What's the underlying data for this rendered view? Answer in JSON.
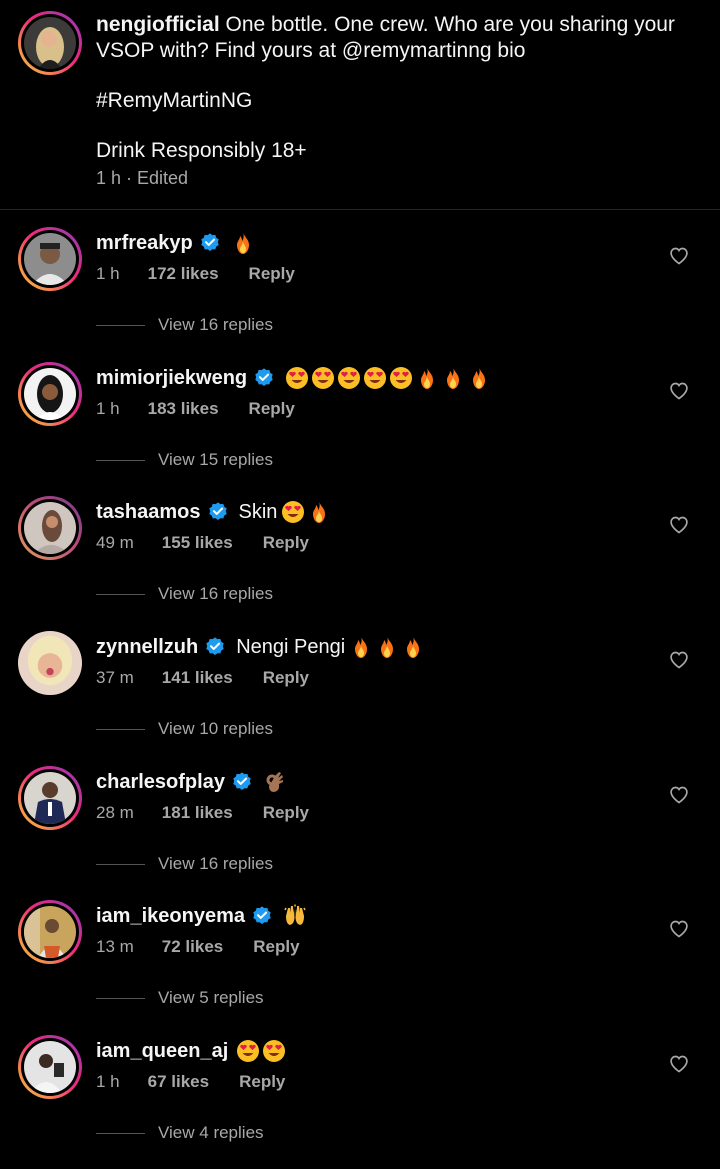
{
  "caption": {
    "username": "nengiofficial",
    "text": "One bottle. One crew. Who are you sharing your VSOP with? Find yours at @remymartinng bio",
    "hashtag": "#RemyMartinNG",
    "note": "Drink Responsibly 18+",
    "meta": "1 h · Edited"
  },
  "comments": [
    {
      "username": "mrfreakyp",
      "verified": true,
      "text": "",
      "emojis": [
        "fire"
      ],
      "time": "1 h",
      "likes": "172 likes",
      "reply": "Reply",
      "view_replies": "View 16 replies",
      "avatar": "ring"
    },
    {
      "username": "mimiorjiekweng",
      "verified": true,
      "text": "",
      "emojis": [
        "heart-eyes",
        "heart-eyes",
        "heart-eyes",
        "heart-eyes",
        "heart-eyes",
        "fire",
        "fire",
        "fire"
      ],
      "time": "1 h",
      "likes": "183 likes",
      "reply": "Reply",
      "view_replies": "View 15 replies",
      "avatar": "ring"
    },
    {
      "username": "tashaamos",
      "verified": true,
      "text": "Skin",
      "emojis": [
        "heart-eyes",
        "fire"
      ],
      "time": "49 m",
      "likes": "155 likes",
      "reply": "Reply",
      "view_replies": "View 16 replies",
      "avatar": "ring-faded"
    },
    {
      "username": "zynnellzuh",
      "verified": true,
      "text": "Nengi Pengi",
      "emojis": [
        "fire",
        "fire",
        "fire"
      ],
      "time": "37 m",
      "likes": "141 likes",
      "reply": "Reply",
      "view_replies": "View 10 replies",
      "avatar": "plain"
    },
    {
      "username": "charlesofplay",
      "verified": true,
      "text": "",
      "emojis": [
        "ok-hand"
      ],
      "time": "28 m",
      "likes": "181 likes",
      "reply": "Reply",
      "view_replies": "View 16 replies",
      "avatar": "ring"
    },
    {
      "username": "iam_ikeonyema",
      "verified": true,
      "text": "",
      "emojis": [
        "raised-hands"
      ],
      "time": "13 m",
      "likes": "72 likes",
      "reply": "Reply",
      "view_replies": "View 5 replies",
      "avatar": "ring"
    },
    {
      "username": "iam_queen_aj",
      "verified": false,
      "text": "",
      "emojis": [
        "heart-eyes",
        "heart-eyes"
      ],
      "time": "1 h",
      "likes": "67 likes",
      "reply": "Reply",
      "view_replies": "View 4 replies",
      "avatar": "ring"
    }
  ],
  "colors": {
    "background": "#000000",
    "text": "#f5f5f5",
    "secondary_text": "#a8a8a8",
    "verified": "#1d9bf0",
    "divider": "#262626"
  },
  "icons": {
    "verified": "verified-badge-icon",
    "like": "heart-outline-icon"
  }
}
